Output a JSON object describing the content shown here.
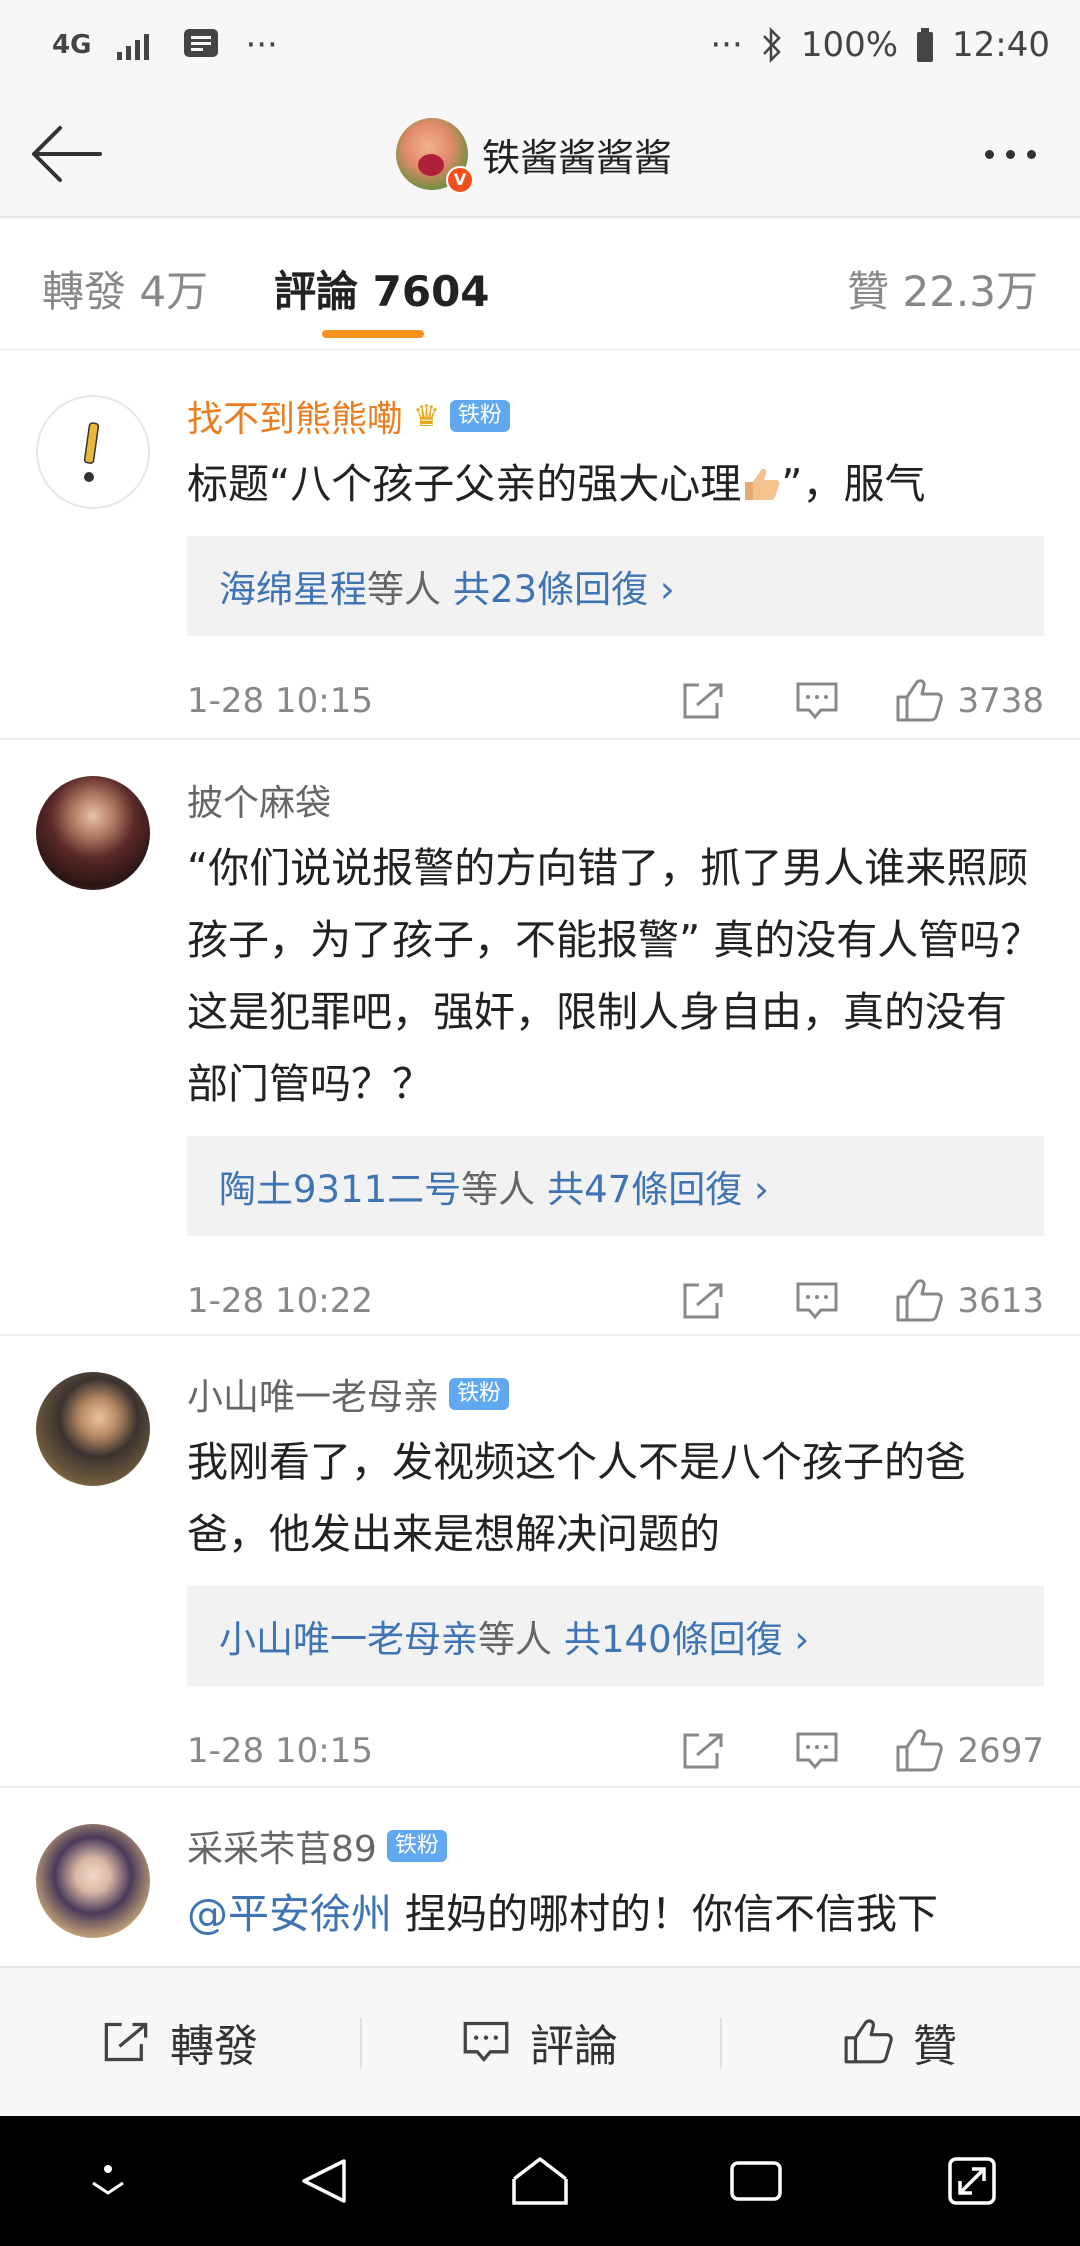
{
  "status_bar": {
    "network": "4G",
    "dots": "···",
    "battery": "100%",
    "time": "12:40"
  },
  "header": {
    "title": "铁酱酱酱酱",
    "verified_badge": "V"
  },
  "tabs": {
    "reposts": "轉發 4万",
    "comments": "評論 7604",
    "likes": "贊 22.3万"
  },
  "comments": [
    {
      "name": "找不到熊熊嘞",
      "badge": "铁粉",
      "text_before": "标题“八个孩子父亲的强大心理",
      "text_after": "”，服气",
      "reply_user": "海绵星程",
      "reply_mid": "等人",
      "reply_count": "共23條回復 ›",
      "time": "1-28 10:15",
      "likes": "3738"
    },
    {
      "name": "披个麻袋",
      "text": "“你们说说报警的方向错了，抓了男人谁来照顾孩子，为了孩子，不能报警” 真的没有人管吗？这是犯罪吧，强奸，限制人身自由，真的没有部门管吗？？",
      "reply_user": "陶土9311二号",
      "reply_mid": "等人",
      "reply_count": "共47條回復 ›",
      "time": "1-28 10:22",
      "likes": "3613"
    },
    {
      "name": "小山唯一老母亲",
      "badge": "铁粉",
      "text": "我刚看了，发视频这个人不是八个孩子的爸爸，他发出来是想解决问题的",
      "reply_user": "小山唯一老母亲",
      "reply_mid": "等人",
      "reply_count": "共140條回復 ›",
      "time": "1-28 10:15",
      "likes": "2697"
    },
    {
      "name": "采采芣苢89",
      "badge": "铁粉",
      "mention": "@平安徐州",
      "text": " 捏妈的哪村的！你信不信我下"
    }
  ],
  "bottom_bar": {
    "repost": "轉發",
    "comment": "評論",
    "like": "贊"
  },
  "colors": {
    "accent_orange": "#f7931e",
    "link_blue": "#3f74b4",
    "fan_badge": "#60a8ef",
    "vip_name": "#eb7d1f"
  }
}
